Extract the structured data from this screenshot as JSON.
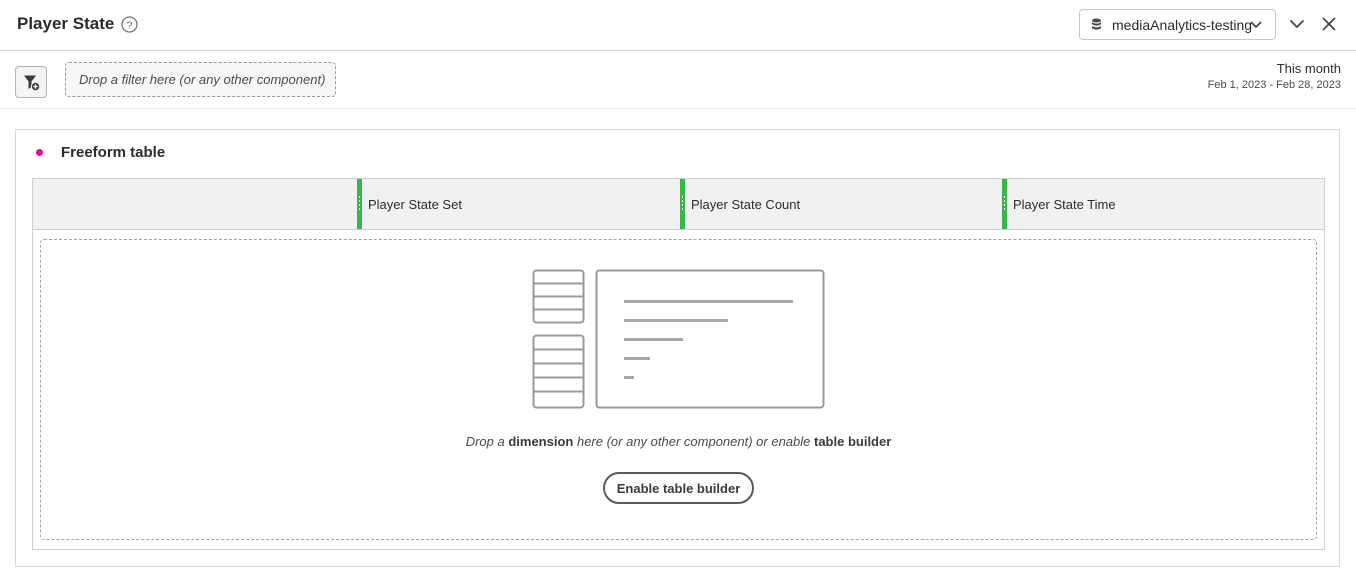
{
  "header": {
    "title": "Player State",
    "report_suite": "mediaAnalytics-testing"
  },
  "filter_bar": {
    "drop_placeholder": "Drop a filter here (or any other component)",
    "date_title": "This month",
    "date_range": "Feb 1, 2023 - Feb 28, 2023"
  },
  "panel": {
    "title": "Freeform table",
    "accent_color": "#e0128a",
    "columns": [
      {
        "label": "Player State Set"
      },
      {
        "label": "Player State Count"
      },
      {
        "label": "Player State Time"
      }
    ],
    "column_marker_color": "#3ab54a",
    "drop_message": {
      "prefix": "Drop a ",
      "dimension": "dimension",
      "middle": " here (or any other component) or enable ",
      "builder": "table builder"
    },
    "enable_button": "Enable table builder"
  },
  "icons": [
    "help-icon",
    "database-icon",
    "chevron-down-icon",
    "collapse-icon",
    "close-icon",
    "filter-add-icon"
  ]
}
